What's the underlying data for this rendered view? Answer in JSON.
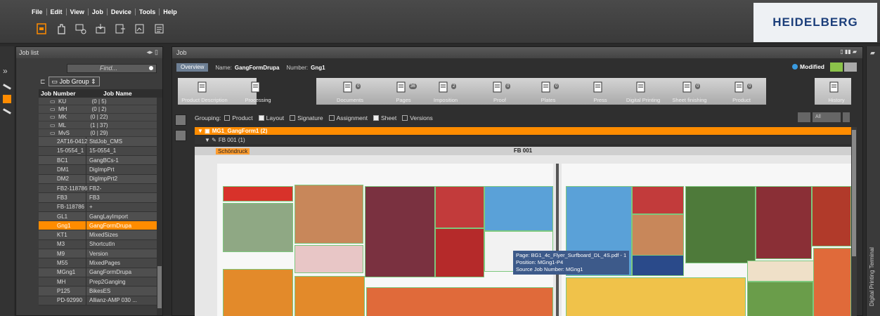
{
  "menu": [
    "File",
    "Edit",
    "View",
    "Job",
    "Device",
    "Tools",
    "Help"
  ],
  "brand": "HEIDELBERG",
  "joblist": {
    "title": "Job list",
    "find_placeholder": "Find...",
    "group_select": "Job Group",
    "col_number": "Job Number",
    "col_name": "Job Name",
    "groups": [
      {
        "name": "KU",
        "count": "(0 | 5)"
      },
      {
        "name": "MH",
        "count": "(0 | 2)"
      },
      {
        "name": "MK",
        "count": "(0 | 22)"
      },
      {
        "name": "ML",
        "count": "(1 | 37)"
      },
      {
        "name": "MvS",
        "count": "(0 | 29)"
      }
    ],
    "rows": [
      {
        "number": "2AT16-0412",
        "name": "StdJob_CMS"
      },
      {
        "number": "15-0554_1",
        "name": "15-0554_1"
      },
      {
        "number": "BC1",
        "name": "GangBCs-1"
      },
      {
        "number": "DM1",
        "name": "DigImpPrt"
      },
      {
        "number": "DM2",
        "name": "DigImpPrt2"
      },
      {
        "number": "FB2-118786",
        "name": "FB2-"
      },
      {
        "number": "FB3",
        "name": "FB3"
      },
      {
        "number": "FB-118786",
        "name": "+"
      },
      {
        "number": "GL1",
        "name": "GangLayImport"
      },
      {
        "number": "Gng1",
        "name": "GangFormDrupa"
      },
      {
        "number": "KT1",
        "name": "MixedSizes"
      },
      {
        "number": "M3",
        "name": "ShortcutIn"
      },
      {
        "number": "M9",
        "name": "Version"
      },
      {
        "number": "M55",
        "name": "MixedPages"
      },
      {
        "number": "MGng1",
        "name": "GangFormDrupa"
      },
      {
        "number": "MH",
        "name": "Prep2Ganging"
      },
      {
        "number": "P125",
        "name": "BikesES"
      },
      {
        "number": "PD-92990",
        "name": "Allianz-AMP 030 ..."
      }
    ],
    "selected_index": 9
  },
  "job": {
    "title": "Job",
    "overview": "Overview",
    "name_label": "Name:",
    "name_value": "GangFormDrupa",
    "number_label": "Number:",
    "number_value": "Gng1",
    "modified": "Modified",
    "steps": [
      {
        "label": "Product Description",
        "badge": ""
      },
      {
        "label": "Processing",
        "badge": ""
      },
      {
        "label": "Documents",
        "badge": "0"
      },
      {
        "label": "Pages",
        "badge": "36"
      },
      {
        "label": "Imposition",
        "badge": "2"
      },
      {
        "label": "Proof",
        "badge": "0"
      },
      {
        "label": "Plates",
        "badge": "0"
      },
      {
        "label": "Press",
        "badge": ""
      },
      {
        "label": "Digital Printing",
        "badge": ""
      },
      {
        "label": "Sheet finishing",
        "badge": "0"
      },
      {
        "label": "Product",
        "badge": "0"
      },
      {
        "label": "History",
        "badge": ""
      }
    ],
    "grouping": {
      "label": "Grouping:",
      "options": [
        {
          "label": "Product",
          "checked": false
        },
        {
          "label": "Layout",
          "checked": true
        },
        {
          "label": "Signature",
          "checked": false
        },
        {
          "label": "Assignment",
          "checked": false
        },
        {
          "label": "Sheet",
          "checked": true
        },
        {
          "label": "Versions",
          "checked": false
        }
      ],
      "all_label": "All"
    },
    "tree": {
      "group": "MG1_GangForm1 (2)",
      "child": "FB 001 (1)"
    },
    "sheet": {
      "header": "FB 001",
      "side_label": "Schöndruck"
    },
    "tooltip": {
      "page": "Page: BG1_4c_Flyer_Surfboard_DL_4S.pdf - 1",
      "position": "Position: MGng1-P4",
      "source": "Source Job Number: MGng1"
    }
  },
  "right_strip": "Digital Printing Terminal",
  "colors": {
    "accent": "#ff8c00",
    "brand": "#1b3e7a"
  }
}
